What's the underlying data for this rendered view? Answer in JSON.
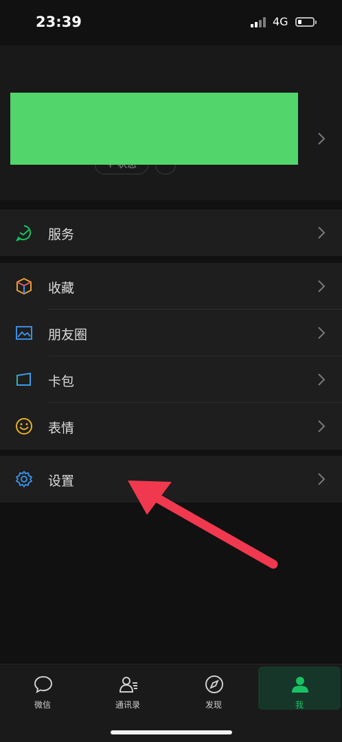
{
  "status_bar": {
    "time": "23:39",
    "network": "4G"
  },
  "profile": {
    "status_button": "+ 状态",
    "more_button": "···"
  },
  "menu": {
    "services": {
      "label": "服务"
    },
    "favorites": {
      "label": "收藏"
    },
    "moments": {
      "label": "朋友圈"
    },
    "cards": {
      "label": "卡包"
    },
    "stickers": {
      "label": "表情"
    },
    "settings": {
      "label": "设置"
    }
  },
  "tabbar": {
    "tabs": [
      {
        "label": "微信",
        "icon": "chat-bubble-icon"
      },
      {
        "label": "通讯录",
        "icon": "contacts-icon"
      },
      {
        "label": "发现",
        "icon": "compass-icon"
      },
      {
        "label": "我",
        "icon": "person-icon",
        "active": true
      }
    ]
  },
  "colors": {
    "accent": "#19c162",
    "redaction": "#52d56b",
    "annotation_arrow": "#f0394f"
  }
}
